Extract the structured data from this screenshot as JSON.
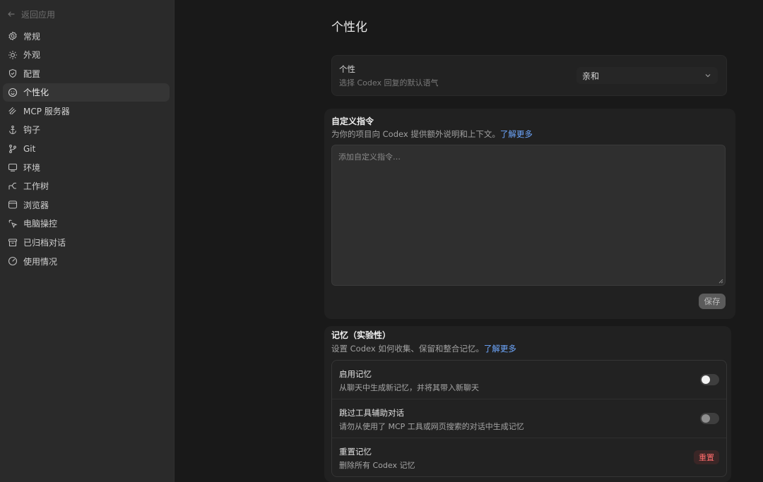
{
  "sidebar": {
    "back_label": "返回应用",
    "items": [
      {
        "label": "常规",
        "icon": "gear-icon"
      },
      {
        "label": "外观",
        "icon": "sun-icon"
      },
      {
        "label": "配置",
        "icon": "shield-icon"
      },
      {
        "label": "个性化",
        "icon": "face-icon"
      },
      {
        "label": "MCP 服务器",
        "icon": "plug-icon"
      },
      {
        "label": "钩子",
        "icon": "anchor-icon"
      },
      {
        "label": "Git",
        "icon": "git-branch-icon"
      },
      {
        "label": "环境",
        "icon": "laptop-icon"
      },
      {
        "label": "工作树",
        "icon": "tree-icon"
      },
      {
        "label": "浏览器",
        "icon": "browser-icon"
      },
      {
        "label": "电脑操控",
        "icon": "pointer-icon"
      },
      {
        "label": "已归档对话",
        "icon": "archive-icon"
      },
      {
        "label": "使用情况",
        "icon": "gauge-icon"
      }
    ],
    "active_index": 3
  },
  "main": {
    "title": "个性化",
    "personality": {
      "label": "个性",
      "description": "选择 Codex 回复的默认语气",
      "selected": "亲和"
    },
    "custom_instructions": {
      "title": "自定义指令",
      "description": "为你的项目向 Codex 提供额外说明和上下文。",
      "link": "了解更多",
      "placeholder": "添加自定义指令…",
      "save_label": "保存"
    },
    "memory": {
      "title": "记忆（实验性）",
      "description": "设置 Codex 如何收集、保留和整合记忆。",
      "link": "了解更多",
      "rows": [
        {
          "title": "启用记忆",
          "description": "从聊天中生成新记忆，并将其带入新聊天",
          "control": "toggle",
          "on": false
        },
        {
          "title": "跳过工具辅助对话",
          "description": "请勿从使用了 MCP 工具或网页搜索的对话中生成记忆",
          "control": "toggle",
          "on": false
        },
        {
          "title": "重置记忆",
          "description": "删除所有 Codex 记忆",
          "control": "button",
          "button_label": "重置"
        }
      ]
    }
  },
  "colors": {
    "accent_link": "#6ea8ff",
    "danger": "#ff6b6b"
  }
}
